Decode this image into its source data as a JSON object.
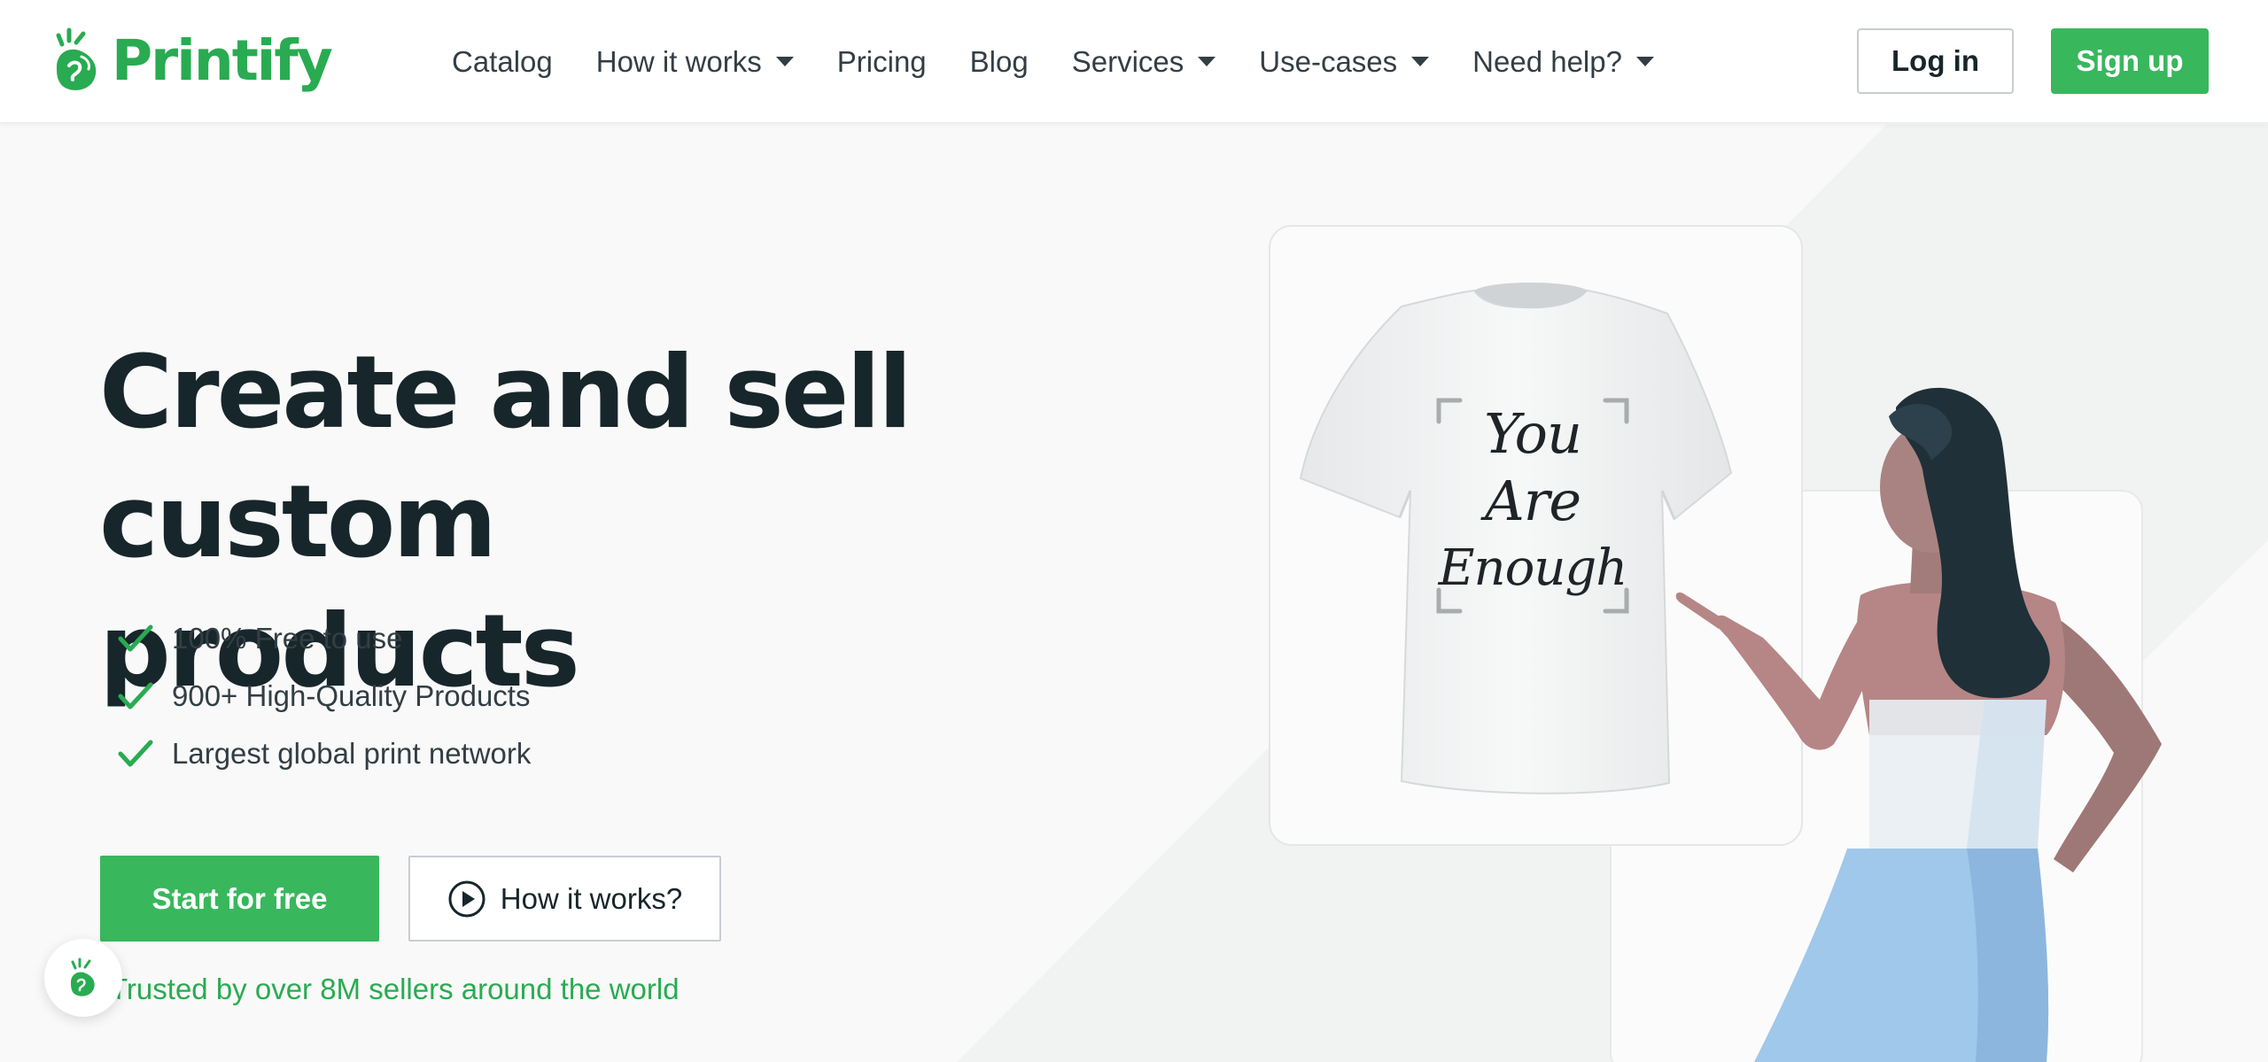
{
  "brand": {
    "name": "Printify",
    "accent": "#39b75d",
    "text_color": "#17262b"
  },
  "nav": {
    "items": [
      {
        "label": "Catalog",
        "dropdown": false
      },
      {
        "label": "How it works",
        "dropdown": true
      },
      {
        "label": "Pricing",
        "dropdown": false
      },
      {
        "label": "Blog",
        "dropdown": false
      },
      {
        "label": "Services",
        "dropdown": true
      },
      {
        "label": "Use-cases",
        "dropdown": true
      },
      {
        "label": "Need help?",
        "dropdown": true
      }
    ],
    "login_label": "Log in",
    "signup_label": "Sign up"
  },
  "hero": {
    "title_line1": "Create and sell",
    "title_line2": "custom products",
    "features": [
      "100% Free to use",
      "900+ High-Quality Products",
      "Largest global print network"
    ],
    "primary_cta": "Start for free",
    "secondary_cta": "How it works?",
    "trusted_text": "Trusted by over 8M sellers around the world"
  },
  "tshirt_print": {
    "line1": "You",
    "line2": "Are",
    "line3": "Enough"
  },
  "icons": {
    "logo": "printify-logo-icon",
    "check": "check-icon",
    "play": "play-circle-icon",
    "caret": "caret-down-icon",
    "chat": "printify-badge-icon"
  }
}
